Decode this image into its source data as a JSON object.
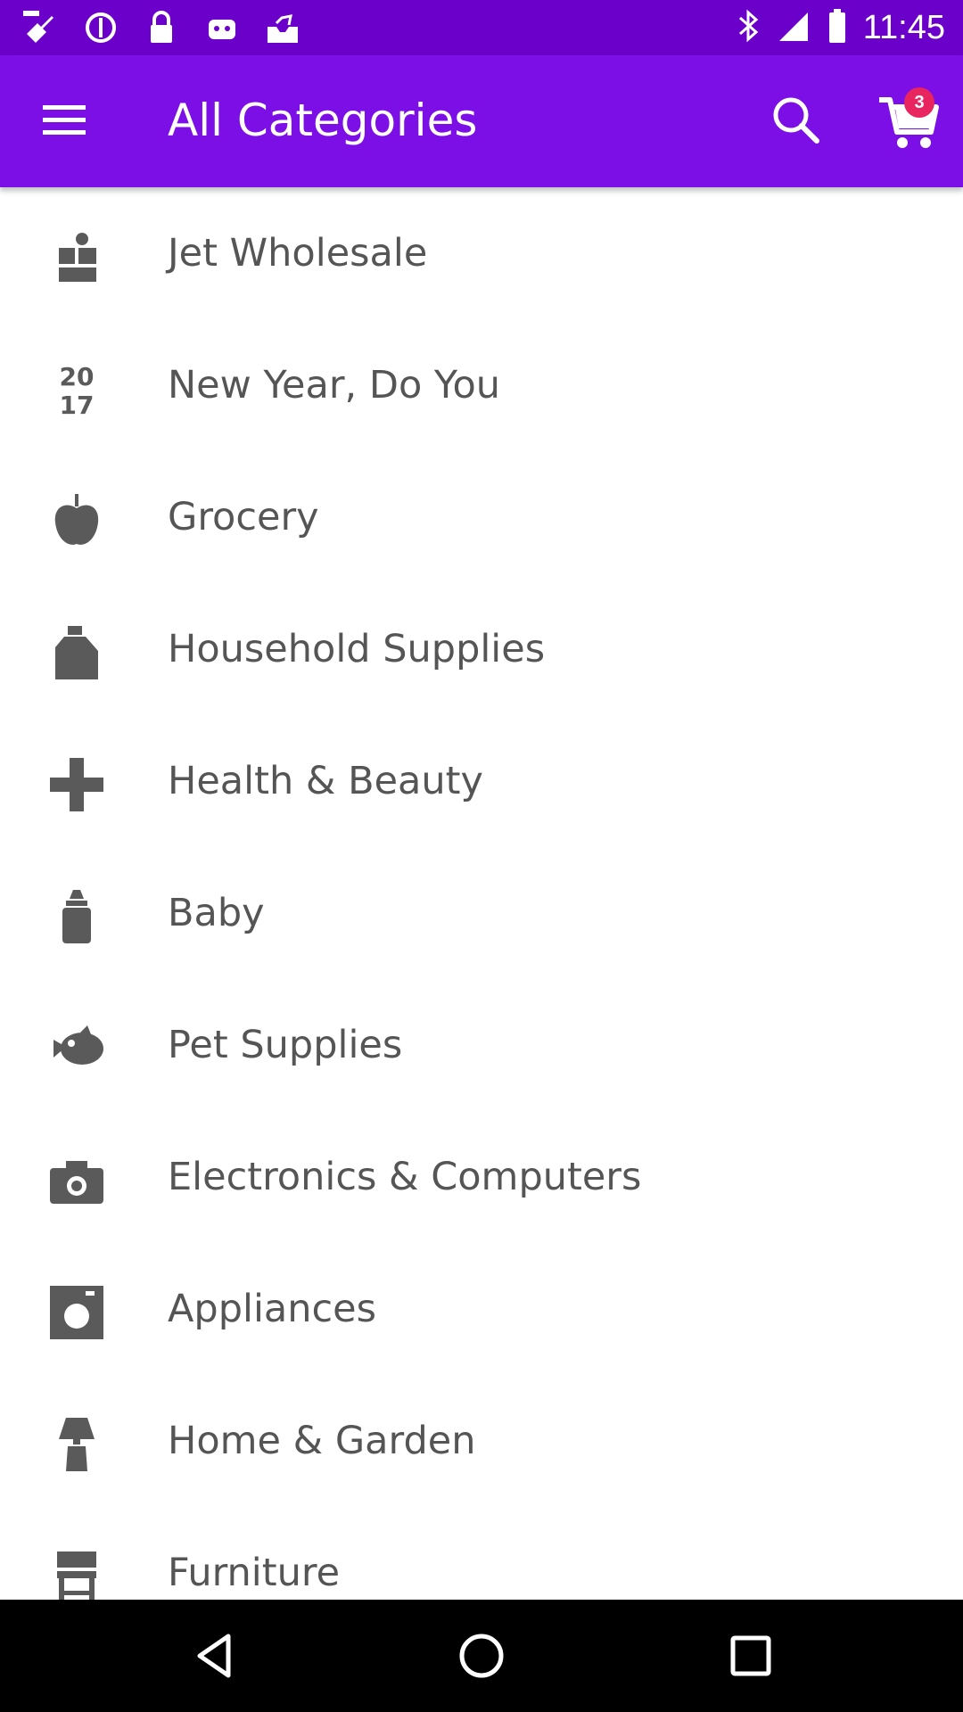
{
  "status_bar": {
    "time": "11:45",
    "icons": [
      "fake-gps-icon",
      "blocked-icon",
      "lock-icon",
      "android-icon",
      "inbox-icon",
      "bluetooth-icon",
      "signal-icon",
      "battery-icon"
    ]
  },
  "app_bar": {
    "title": "All Categories",
    "cart_count": "3",
    "colors": {
      "app_bar": "#7b0fe6",
      "status_bar": "#6a00c9",
      "badge": "#e8255f"
    }
  },
  "categories": [
    {
      "label": "Jet Wholesale",
      "icon": "wholesale-icon"
    },
    {
      "label": "New Year, Do You",
      "icon": "year-2017-icon",
      "icon_text_top": "20",
      "icon_text_bottom": "17"
    },
    {
      "label": "Grocery",
      "icon": "apple-icon"
    },
    {
      "label": "Household Supplies",
      "icon": "detergent-bottle-icon"
    },
    {
      "label": "Health & Beauty",
      "icon": "plus-icon"
    },
    {
      "label": "Baby",
      "icon": "baby-bottle-icon"
    },
    {
      "label": "Pet Supplies",
      "icon": "fish-icon"
    },
    {
      "label": "Electronics & Computers",
      "icon": "camera-icon"
    },
    {
      "label": "Appliances",
      "icon": "washing-machine-icon"
    },
    {
      "label": "Home & Garden",
      "icon": "lamp-icon"
    },
    {
      "label": "Furniture",
      "icon": "chair-icon"
    }
  ],
  "nav_bar": {
    "buttons": [
      "back-icon",
      "home-icon",
      "recents-icon"
    ]
  }
}
